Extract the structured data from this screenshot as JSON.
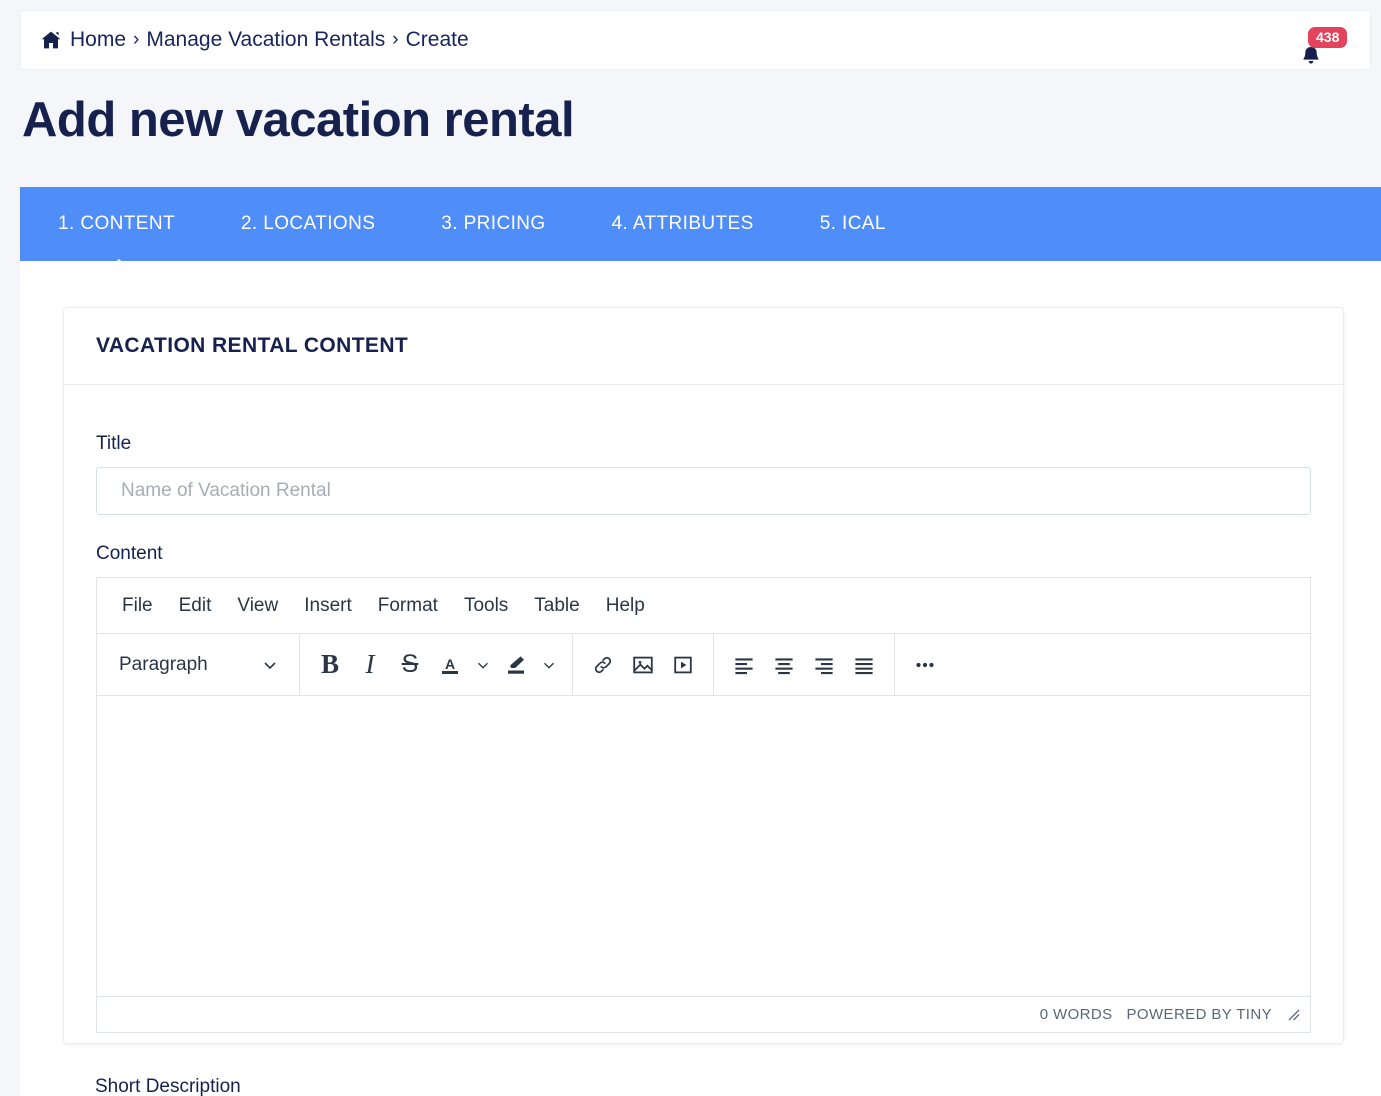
{
  "breadcrumb": {
    "home_icon": "home-icon",
    "items": [
      "Home",
      "Manage Vacation Rentals",
      "Create"
    ],
    "separator": "›"
  },
  "notifications": {
    "icon": "bell-icon",
    "count": "438"
  },
  "header": {
    "page_title": "Add new vacation rental"
  },
  "tabs": {
    "active_index": 0,
    "items": [
      {
        "label": "1. CONTENT"
      },
      {
        "label": "2. LOCATIONS"
      },
      {
        "label": "3. PRICING"
      },
      {
        "label": "4. ATTRIBUTES"
      },
      {
        "label": "5. ICAL"
      }
    ]
  },
  "card": {
    "title": "VACATION RENTAL CONTENT"
  },
  "form": {
    "title_field": {
      "label": "Title",
      "placeholder": "Name of Vacation Rental",
      "value": ""
    },
    "content_field": {
      "label": "Content"
    },
    "short_description_field": {
      "label": "Short Description"
    }
  },
  "editor": {
    "menubar": [
      "File",
      "Edit",
      "View",
      "Insert",
      "Format",
      "Tools",
      "Table",
      "Help"
    ],
    "format_select": {
      "value": "Paragraph",
      "chevron_icon": "chevron-down-icon"
    },
    "toolbar": [
      {
        "name": "bold-button",
        "glyph": "B"
      },
      {
        "name": "italic-button",
        "glyph": "I"
      },
      {
        "name": "strikethrough-button",
        "glyph": "S"
      },
      {
        "name": "text-color-button",
        "glyph": "A"
      },
      {
        "name": "text-color-chevron",
        "glyph": "⌄"
      },
      {
        "name": "highlight-color-button",
        "glyph": "highlighter-icon"
      },
      {
        "name": "highlight-color-chevron",
        "glyph": "⌄"
      },
      {
        "name": "insert-link-button",
        "glyph": "link-icon"
      },
      {
        "name": "insert-image-button",
        "glyph": "image-icon"
      },
      {
        "name": "insert-media-button",
        "glyph": "media-play-icon"
      },
      {
        "name": "align-left-button",
        "glyph": "align-left-icon"
      },
      {
        "name": "align-center-button",
        "glyph": "align-center-icon"
      },
      {
        "name": "align-right-button",
        "glyph": "align-right-icon"
      },
      {
        "name": "align-justify-button",
        "glyph": "align-justify-icon"
      },
      {
        "name": "more-button",
        "glyph": "ellipsis-icon"
      }
    ],
    "status": {
      "word_count": "0 WORDS",
      "branding": "POWERED BY TINY",
      "resize_icon": "resize-handle-icon"
    },
    "content_value": ""
  },
  "colors": {
    "accent_blue": "#4f8df8",
    "navy": "#16214e",
    "badge_red": "#e3435c",
    "page_bg": "#f4f6f9",
    "border": "#e9edf2"
  }
}
